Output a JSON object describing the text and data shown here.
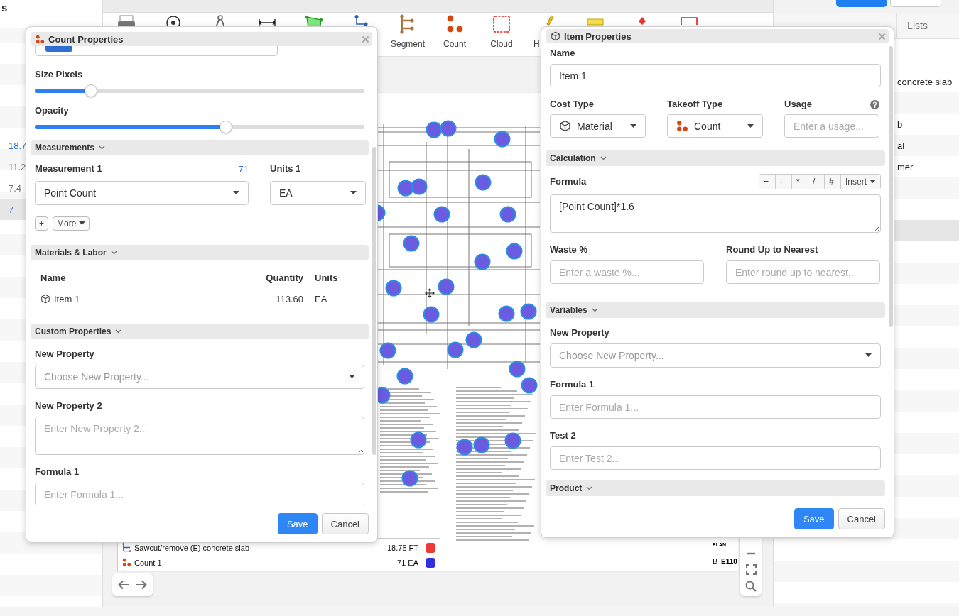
{
  "app_header": {
    "title": "s"
  },
  "sidebar": {
    "rows": [
      {
        "value": "18.7",
        "color": "#2f6fd1",
        "selected": false
      },
      {
        "value": "11.2",
        "color": "#777777",
        "selected": false
      },
      {
        "value": "7.4",
        "color": "#777777",
        "selected": false
      },
      {
        "value": "7",
        "color": "#2f6fd1",
        "selected": true
      }
    ]
  },
  "toolbar": {
    "tools": [
      {
        "kind": "printer"
      },
      {
        "kind": "target"
      },
      {
        "kind": "compass"
      },
      {
        "kind": "dimension"
      },
      {
        "kind": "area"
      },
      {
        "kind": "pin"
      },
      {
        "kind": "segment",
        "label": "Segment"
      },
      {
        "kind": "count",
        "label": "Count"
      },
      {
        "kind": "cloud",
        "label": "Cloud"
      },
      {
        "kind": "highlight",
        "label": "H"
      },
      {
        "kind": "note"
      },
      {
        "kind": "marker"
      },
      {
        "kind": "rectangle"
      }
    ]
  },
  "sheet": {
    "title": "PLAN",
    "revision": "B",
    "number": "E110"
  },
  "legend": [
    {
      "kind": "segment",
      "label": "Sawcut/remove (E) concrete slab",
      "quantity": "18.75 FT",
      "color": "#f03a3a"
    },
    {
      "kind": "count",
      "label": "Count 1",
      "quantity": "71 EA",
      "color": "#3030e0"
    }
  ],
  "right_panel": {
    "tabs": [
      {
        "label": "Lists"
      }
    ],
    "rows": [
      {
        "text": "concrete slab",
        "selected": false
      },
      {
        "selected": false
      },
      {
        "text": "b",
        "selected": false
      },
      {
        "text": "al",
        "selected": false
      },
      {
        "text": "mer",
        "selected": false
      },
      {
        "selected": false
      },
      {
        "selected": false
      },
      {
        "selected": true
      }
    ]
  },
  "count_dialog": {
    "title": "Count Properties",
    "size_pixels": {
      "label": "Size Pixels",
      "level": 0.17
    },
    "opacity": {
      "label": "Opacity",
      "level": 0.58
    },
    "measurements": {
      "title": "Measurements",
      "measurement_label": "Measurement 1",
      "measurement_count": "71",
      "units_label": "Units 1",
      "measurement_value": "Point Count",
      "units_value": "EA",
      "add": "+",
      "more": "More"
    },
    "materials": {
      "title": "Materials & Labor",
      "columns": [
        "Name",
        "Quantity",
        "Units"
      ],
      "rows": [
        {
          "name": "Item 1",
          "quantity": "113.60",
          "units": "EA"
        }
      ]
    },
    "custom_properties": {
      "title": "Custom Properties",
      "fields": [
        {
          "kind": "select",
          "label": "New Property",
          "placeholder": "Choose New Property..."
        },
        {
          "kind": "textarea",
          "label": "New Property 2",
          "placeholder": "Enter New Property 2..."
        },
        {
          "kind": "input",
          "label": "Formula 1",
          "placeholder": "Enter Formula 1..."
        }
      ]
    },
    "buttons": [
      {
        "kind": "primary",
        "label": "Save"
      },
      {
        "kind": "secondary",
        "label": "Cancel"
      }
    ]
  },
  "item_dialog": {
    "title": "Item Properties",
    "name": {
      "label": "Name",
      "value": "Item 1"
    },
    "cost_type": {
      "label": "Cost Type",
      "value": "Material",
      "kind": "box"
    },
    "takeoff_type": {
      "label": "Takeoff Type",
      "value": "Count",
      "kind": "count"
    },
    "usage": {
      "label": "Usage",
      "placeholder": "Enter a usage..."
    },
    "calculation": {
      "title": "Calculation",
      "formula_label": "Formula",
      "operators": [
        "+",
        "-",
        "*",
        "/",
        "#"
      ],
      "insert": "Insert",
      "formula": "[Point Count]*1.6",
      "waste": {
        "label": "Waste %",
        "placeholder": "Enter a waste %..."
      },
      "round_up": {
        "label": "Round Up to Nearest",
        "placeholder": "Enter round up to nearest..."
      }
    },
    "variables": {
      "title": "Variables",
      "fields": [
        {
          "kind": "select",
          "label": "New Property",
          "placeholder": "Choose New Property..."
        },
        {
          "kind": "input",
          "label": "Formula 1",
          "placeholder": "Enter Formula 1..."
        },
        {
          "kind": "input",
          "label": "Test 2",
          "placeholder": "Enter Test 2..."
        }
      ]
    },
    "product": {
      "title": "Product"
    },
    "buttons": [
      {
        "kind": "primary",
        "label": "Save"
      },
      {
        "kind": "secondary",
        "label": "Cancel"
      }
    ]
  }
}
